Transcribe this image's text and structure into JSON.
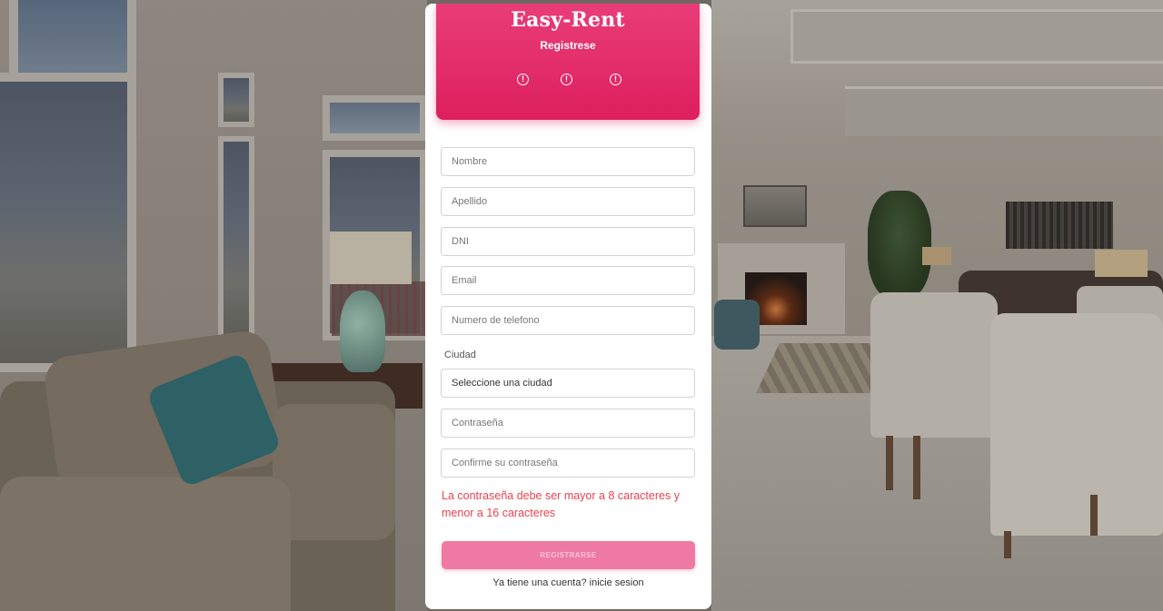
{
  "header": {
    "brand": "Easy-Rent",
    "subtitle": "Registrese",
    "alert_icon_glyph": "!",
    "alert_icons": [
      "alert-circle-icon",
      "alert-circle-icon",
      "alert-circle-icon"
    ]
  },
  "form": {
    "nombre_placeholder": "Nombre",
    "apellido_placeholder": "Apellido",
    "dni_placeholder": "DNI",
    "email_placeholder": "Email",
    "telefono_placeholder": "Numero de telefono",
    "ciudad_label": "Ciudad",
    "ciudad_selected": "Seleccione una ciudad",
    "password_placeholder": "Contraseña",
    "confirm_placeholder": "Confirme su contraseña",
    "error_message": "La contraseña debe ser mayor a 8 caracteres y menor a 16 caracteres",
    "submit_label": "REGISTRARSE",
    "login_prefix": "Ya tiene una cuenta?",
    "login_link": "inicie sesion"
  },
  "colors": {
    "accent": "#e32c6a",
    "button_disabled": "#ee7aa3",
    "error": "#e8434f"
  }
}
